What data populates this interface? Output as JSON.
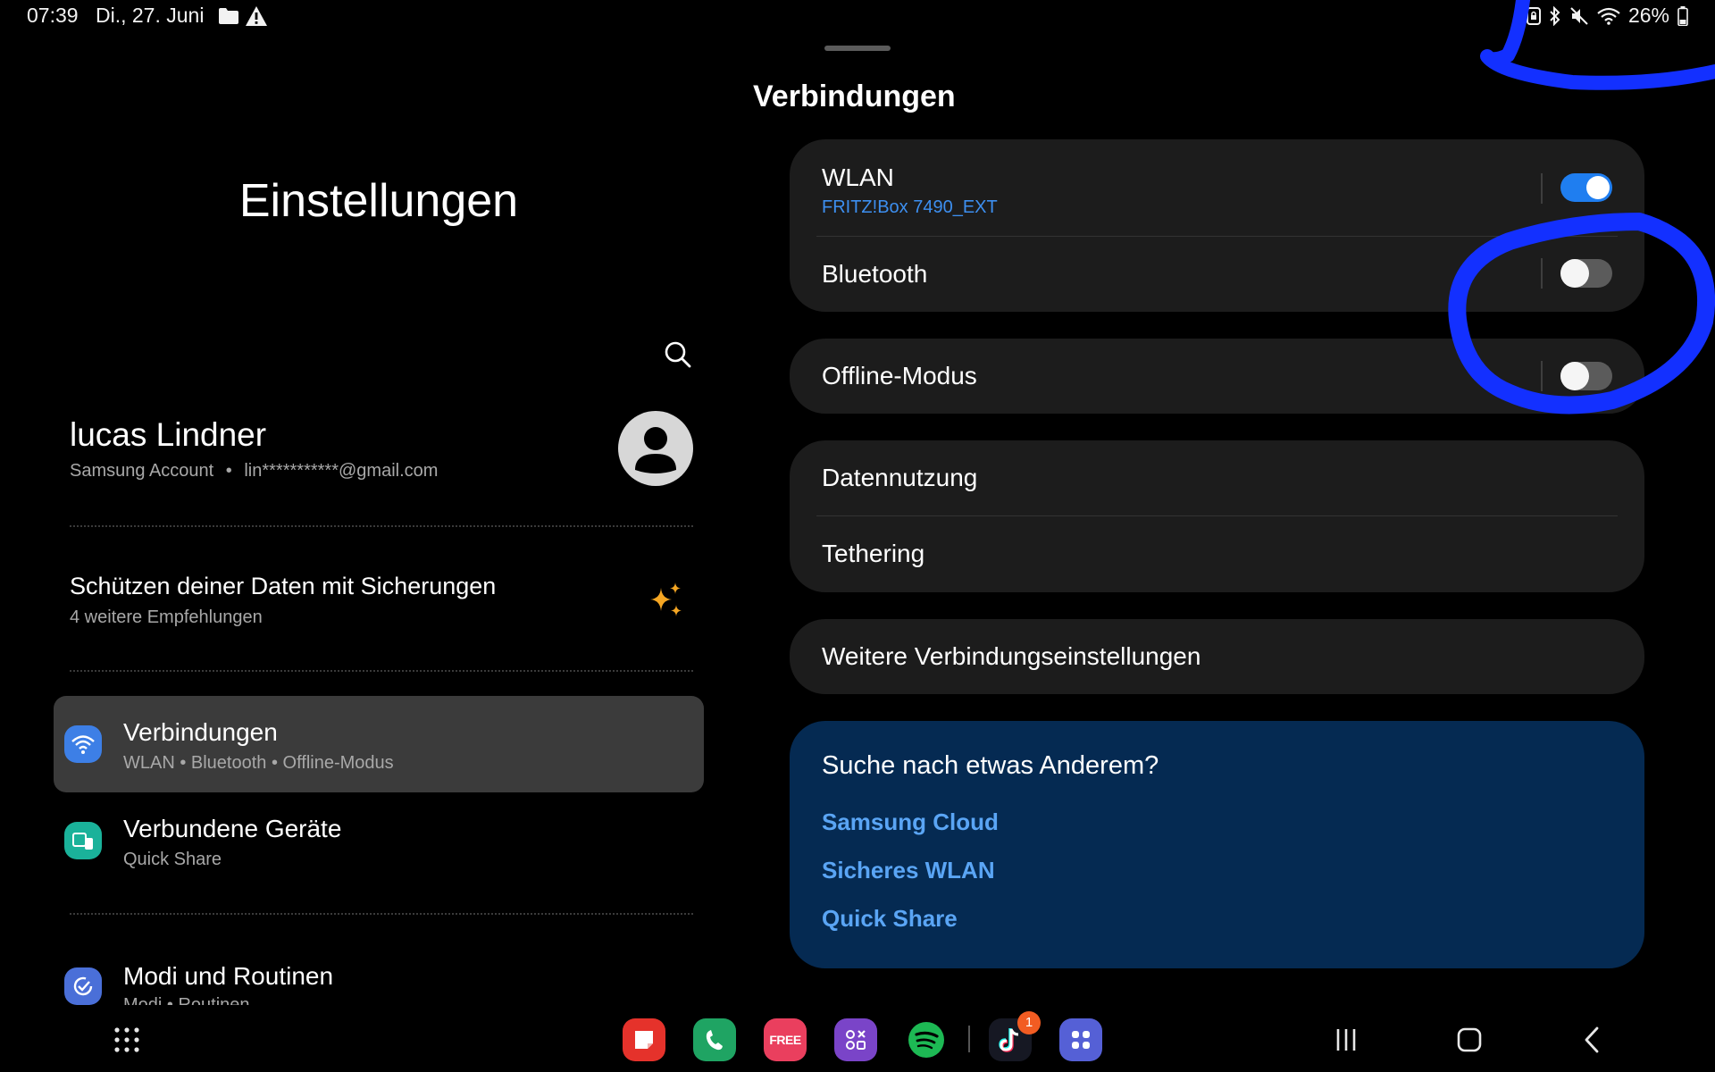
{
  "status_bar": {
    "time": "07:39",
    "date": "Di., 27. Juni",
    "battery": "26%"
  },
  "left_panel": {
    "title": "Einstellungen",
    "profile": {
      "name": "lucas Lindner",
      "account_label": "Samsung Account",
      "email": "lin***********@gmail.com",
      "separator": "•"
    },
    "suggestion": {
      "title": "Schützen deiner Daten mit Sicherungen",
      "subtitle": "4 weitere Empfehlungen"
    },
    "menu": [
      {
        "title": "Verbindungen",
        "subtitle": "WLAN  •  Bluetooth  •  Offline-Modus",
        "icon": "wifi-icon",
        "color": "#3d7fe6"
      },
      {
        "title": "Verbundene Geräte",
        "subtitle": "Quick Share",
        "icon": "connected-devices-icon",
        "color": "#1ab29a"
      },
      {
        "title": "Modi und Routinen",
        "subtitle": "Modi  •  Routinen",
        "icon": "modes-routines-icon",
        "color": "#4a6fd8"
      }
    ]
  },
  "right_panel": {
    "title": "Verbindungen",
    "wlan": {
      "title": "WLAN",
      "network": "FRITZ!Box 7490_EXT",
      "enabled": true
    },
    "bluetooth": {
      "title": "Bluetooth",
      "enabled": false
    },
    "offline": {
      "title": "Offline-Modus",
      "enabled": false
    },
    "data_usage": "Datennutzung",
    "tethering": "Tethering",
    "more_settings": "Weitere Verbindungseinstellungen",
    "suggest": {
      "title": "Suche nach etwas Anderem?",
      "links": [
        "Samsung Cloud",
        "Sicheres WLAN",
        "Quick Share"
      ]
    }
  },
  "dock": {
    "apps": [
      {
        "name": "notes-app-icon",
        "color": "#e5322b"
      },
      {
        "name": "phone-app-icon",
        "color": "#1fa463"
      },
      {
        "name": "free-app-icon",
        "label": "FREE",
        "color": "#ea3f5e"
      },
      {
        "name": "game-launcher-icon",
        "color": "#7a44c8"
      },
      {
        "name": "spotify-icon",
        "color": "#1db954"
      },
      {
        "name": "tiktok-icon",
        "badge": "1",
        "color": "#161823"
      },
      {
        "name": "app-folder-icon",
        "color": "#5560d6"
      }
    ]
  },
  "colors": {
    "accent": "#1f7ef0",
    "link": "#5aa5f5",
    "annotation": "#1330ff"
  }
}
